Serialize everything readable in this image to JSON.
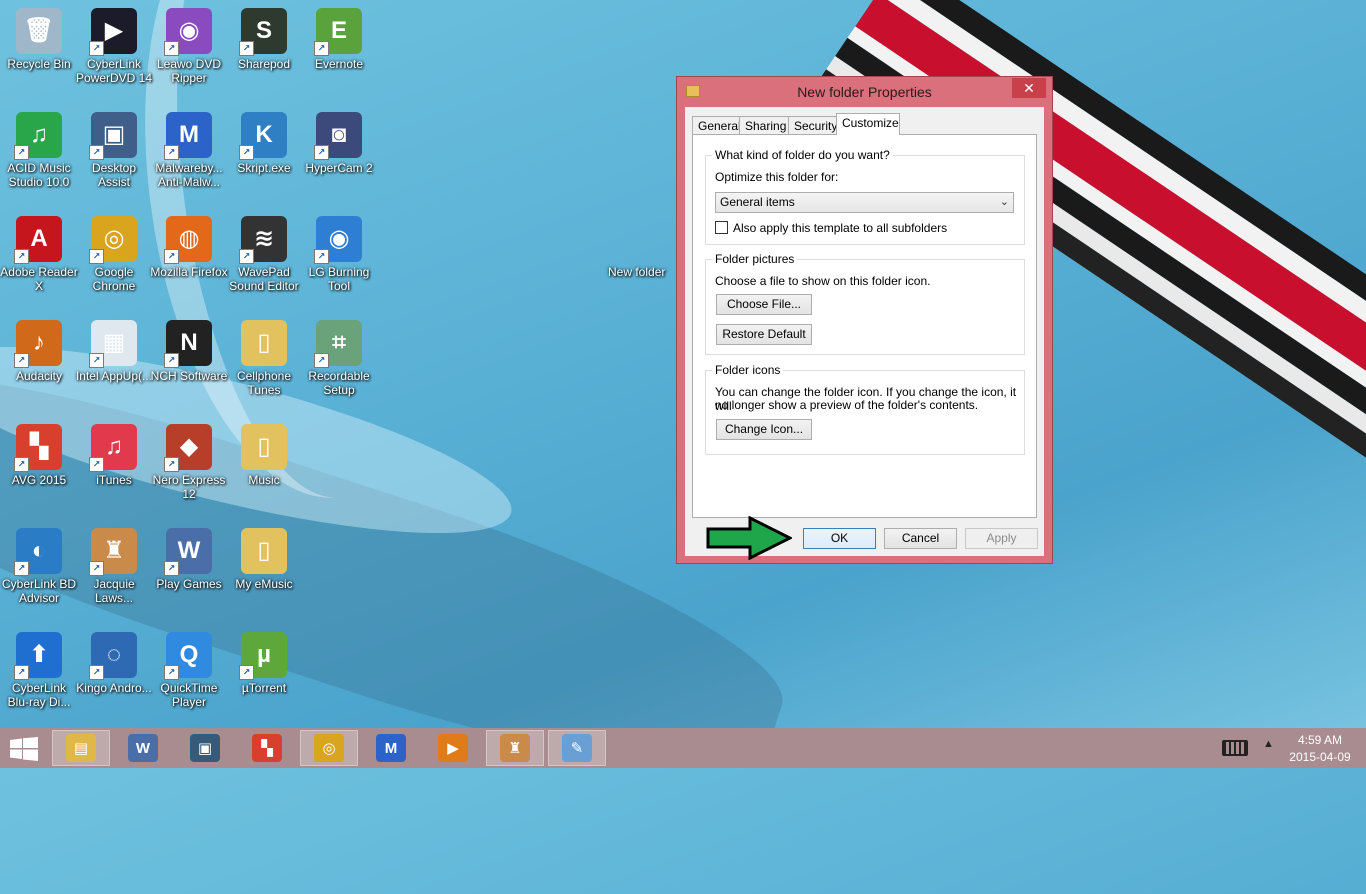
{
  "desktop": {
    "icons": [
      {
        "label": "Recycle Bin",
        "icon": "recycle-bin-icon",
        "color": "#9fb7c9",
        "glyph": "🗑"
      },
      {
        "label": "CyberLink PowerDVD 14",
        "icon": "powerdvd-icon",
        "color": "#1b1b2a",
        "glyph": "▶"
      },
      {
        "label": "Leawo DVD Ripper",
        "icon": "dvd-ripper-icon",
        "color": "#8a4bbf",
        "glyph": "◉"
      },
      {
        "label": "Sharepod",
        "icon": "sharepod-icon",
        "color": "#2d3a2d",
        "glyph": "S"
      },
      {
        "label": "Evernote",
        "icon": "evernote-icon",
        "color": "#5aa33c",
        "glyph": "E"
      },
      {
        "label": "ACID Music Studio 10.0",
        "icon": "acid-music-icon",
        "color": "#2aa64a",
        "glyph": "♫"
      },
      {
        "label": "Desktop Assist",
        "icon": "desktop-assist-icon",
        "color": "#3f5f8a",
        "glyph": "▣"
      },
      {
        "label": "Malwareby... Anti-Malw...",
        "icon": "malwarebytes-icon",
        "color": "#2b63c9",
        "glyph": "M"
      },
      {
        "label": "Skript.exe",
        "icon": "skript-icon",
        "color": "#2f7fc4",
        "glyph": "K"
      },
      {
        "label": "HyperCam 2",
        "icon": "hypercam-icon",
        "color": "#3b4a7a",
        "glyph": "◙"
      },
      {
        "label": "Adobe Reader X",
        "icon": "adobe-reader-icon",
        "color": "#c4161c",
        "glyph": "A"
      },
      {
        "label": "Google Chrome",
        "icon": "chrome-icon",
        "color": "#d9a51f",
        "glyph": "◎"
      },
      {
        "label": "Mozilla Firefox",
        "icon": "firefox-icon",
        "color": "#e3681a",
        "glyph": "◍"
      },
      {
        "label": "WavePad Sound Editor",
        "icon": "wavepad-icon",
        "color": "#333333",
        "glyph": "≋"
      },
      {
        "label": "LG Burning Tool",
        "icon": "lg-burning-icon",
        "color": "#2e7fd3",
        "glyph": "◉"
      },
      {
        "label": "Audacity",
        "icon": "audacity-icon",
        "color": "#d06a1a",
        "glyph": "♪"
      },
      {
        "label": "Intel AppUp(...",
        "icon": "intel-appup-icon",
        "color": "#dfe7ef",
        "glyph": "▦"
      },
      {
        "label": "NCH Software",
        "icon": "nch-icon",
        "color": "#222222",
        "glyph": "N"
      },
      {
        "label": "Cellphone Tunes",
        "icon": "folder-icon",
        "color": "#e2c25e",
        "glyph": "▯"
      },
      {
        "label": "Recordable Setup",
        "icon": "recordable-icon",
        "color": "#6aa27a",
        "glyph": "⌗"
      },
      {
        "label": "AVG 2015",
        "icon": "avg-icon",
        "color": "#d8402e",
        "glyph": "▚"
      },
      {
        "label": "iTunes",
        "icon": "itunes-icon",
        "color": "#e23a4d",
        "glyph": "♫"
      },
      {
        "label": "Nero Express 12",
        "icon": "nero-icon",
        "color": "#b73f2a",
        "glyph": "◆"
      },
      {
        "label": "Music",
        "icon": "folder-icon",
        "color": "#e2c25e",
        "glyph": "▯"
      },
      {
        "label": "",
        "icon": "blank-icon",
        "color": "transparent",
        "glyph": ""
      },
      {
        "label": "CyberLink BD Advisor",
        "icon": "bd-advisor-icon",
        "color": "#2a7cc4",
        "glyph": "◐"
      },
      {
        "label": "Jacquie Laws...",
        "icon": "jacquie-icon",
        "color": "#c98a4a",
        "glyph": "♜"
      },
      {
        "label": "Play Games",
        "icon": "play-games-icon",
        "color": "#4a6fa8",
        "glyph": "W"
      },
      {
        "label": "My eMusic",
        "icon": "folder-icon",
        "color": "#e2c25e",
        "glyph": "▯"
      },
      {
        "label": "",
        "icon": "blank-icon",
        "color": "transparent",
        "glyph": ""
      },
      {
        "label": "CyberLink Blu-ray Di...",
        "icon": "bluray-icon",
        "color": "#1f6fd0",
        "glyph": "⬆"
      },
      {
        "label": "Kingo Andro...",
        "icon": "kingo-icon",
        "color": "#2d6ab3",
        "glyph": "◌"
      },
      {
        "label": "QuickTime Player",
        "icon": "quicktime-icon",
        "color": "#2f8ae0",
        "glyph": "Q"
      },
      {
        "label": "µTorrent",
        "icon": "utorrent-icon",
        "color": "#5ea83b",
        "glyph": "µ"
      }
    ],
    "selected_item_label": "New folder"
  },
  "dialog": {
    "title": "New folder Properties",
    "close_glyph": "✕",
    "tabs": [
      "General",
      "Sharing",
      "Security",
      "Customize"
    ],
    "active_tab": "Customize",
    "kind_group": {
      "title": "What kind of folder do you want?",
      "optimize_label": "Optimize this folder for:",
      "optimize_value": "General items",
      "apply_subfolders_label": "Also apply this template to all subfolders",
      "apply_subfolders_checked": false
    },
    "pictures_group": {
      "title": "Folder pictures",
      "description": "Choose a file to show on this folder icon.",
      "choose_file_button": "Choose File...",
      "restore_default_button": "Restore Default"
    },
    "icons_group": {
      "title": "Folder icons",
      "description_line1": "You can change the folder icon. If you change the icon, it will",
      "description_line2": "no longer show a preview of the folder's contents.",
      "change_icon_button": "Change Icon..."
    },
    "buttons": {
      "ok": "OK",
      "cancel": "Cancel",
      "apply": "Apply"
    },
    "colors": {
      "frame": "#d9707b",
      "close": "#c7404a"
    }
  },
  "taskbar": {
    "items": [
      {
        "icon": "file-explorer-icon",
        "glyph": "▤",
        "color": "#e0b84a",
        "active": true
      },
      {
        "icon": "play-games-icon",
        "glyph": "W",
        "color": "#4a6fa8",
        "active": false
      },
      {
        "icon": "media-icon",
        "glyph": "▣",
        "color": "#355a7a",
        "active": false
      },
      {
        "icon": "avg-icon",
        "glyph": "▚",
        "color": "#d8402e",
        "active": false
      },
      {
        "icon": "chrome-icon",
        "glyph": "◎",
        "color": "#d9a51f",
        "active": true
      },
      {
        "icon": "malwarebytes-icon",
        "glyph": "M",
        "color": "#2b63c9",
        "active": false
      },
      {
        "icon": "video-player-icon",
        "glyph": "▶",
        "color": "#e07b1a",
        "active": false
      },
      {
        "icon": "jacquie-icon",
        "glyph": "♜",
        "color": "#c98a4a",
        "active": true
      },
      {
        "icon": "paint-icon",
        "glyph": "✎",
        "color": "#6a9fd4",
        "active": true
      }
    ],
    "clock_time": "4:59 AM",
    "clock_date": "2015-04-09"
  }
}
